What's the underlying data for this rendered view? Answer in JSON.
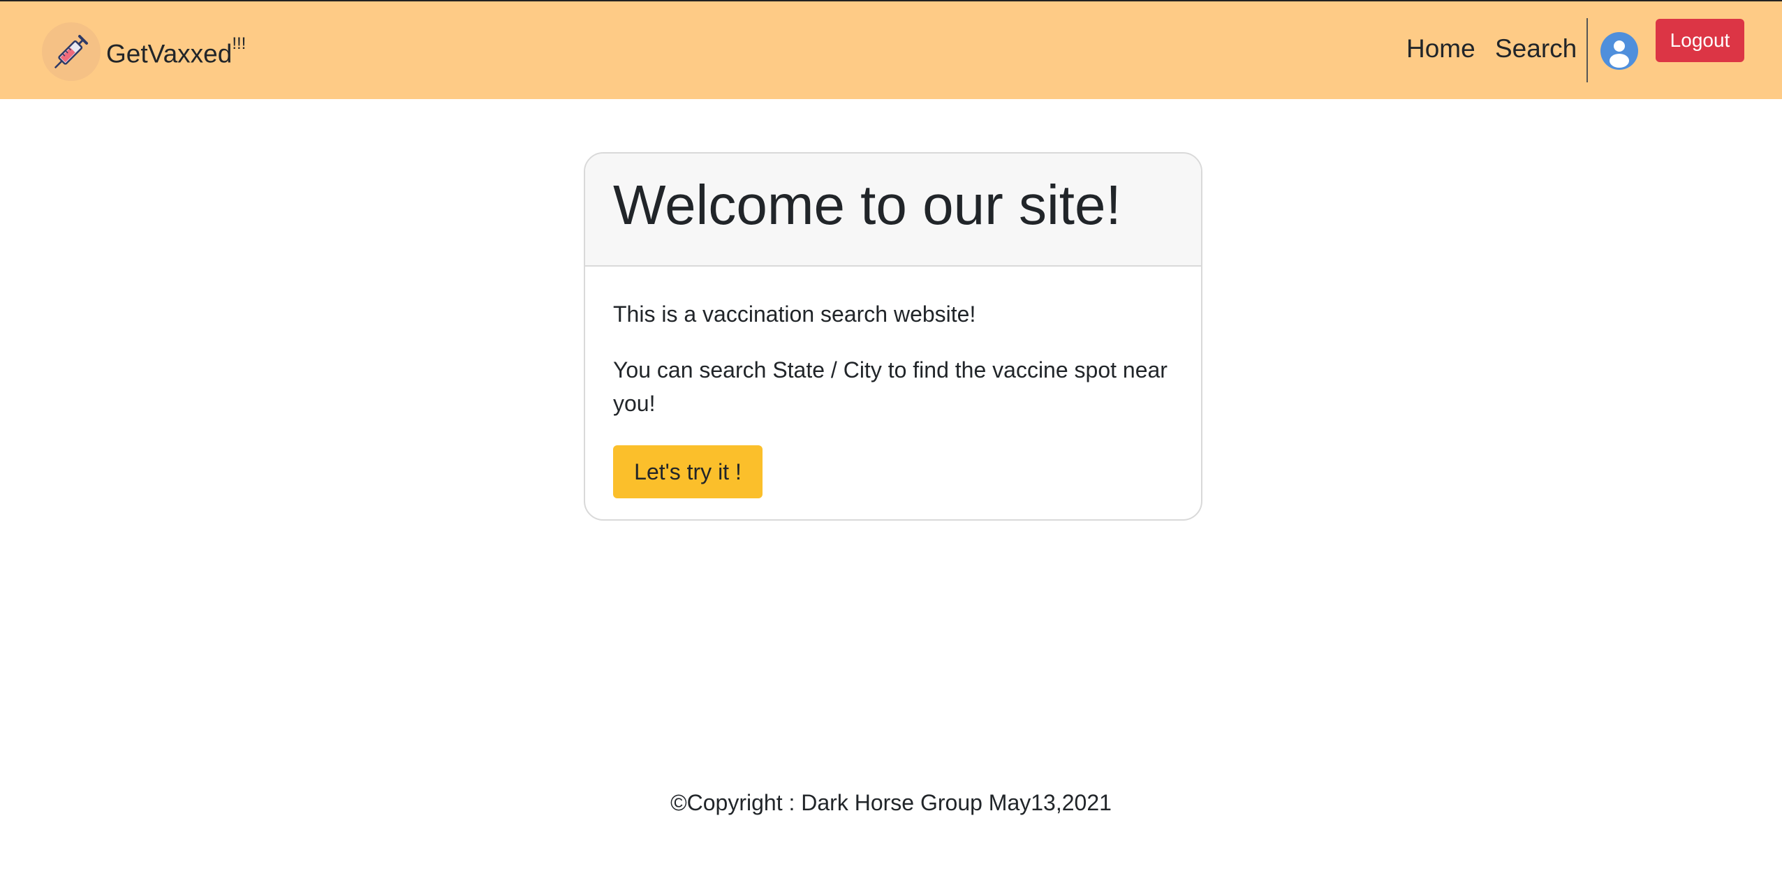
{
  "navbar": {
    "brand_name": "GetVaxxed",
    "brand_suffix": "!!!",
    "brand_icon": "syringe-icon",
    "links": [
      {
        "label": "Home"
      },
      {
        "label": "Search"
      }
    ],
    "user_icon": "user-avatar-icon",
    "logout_label": "Logout",
    "background_color": "#fecb86"
  },
  "card": {
    "title": "Welcome to our site!",
    "paragraphs": [
      "This is a vaccination search website!",
      "You can search State / City to find the vaccine spot near you!"
    ],
    "cta_label": "Let's try it !",
    "cta_color": "#fbbf2b"
  },
  "footer": {
    "text": "©Copyright : Dark Horse Group May13,2021"
  },
  "colors": {
    "logout": "#dc3545",
    "avatar": "#4f8fdc"
  }
}
